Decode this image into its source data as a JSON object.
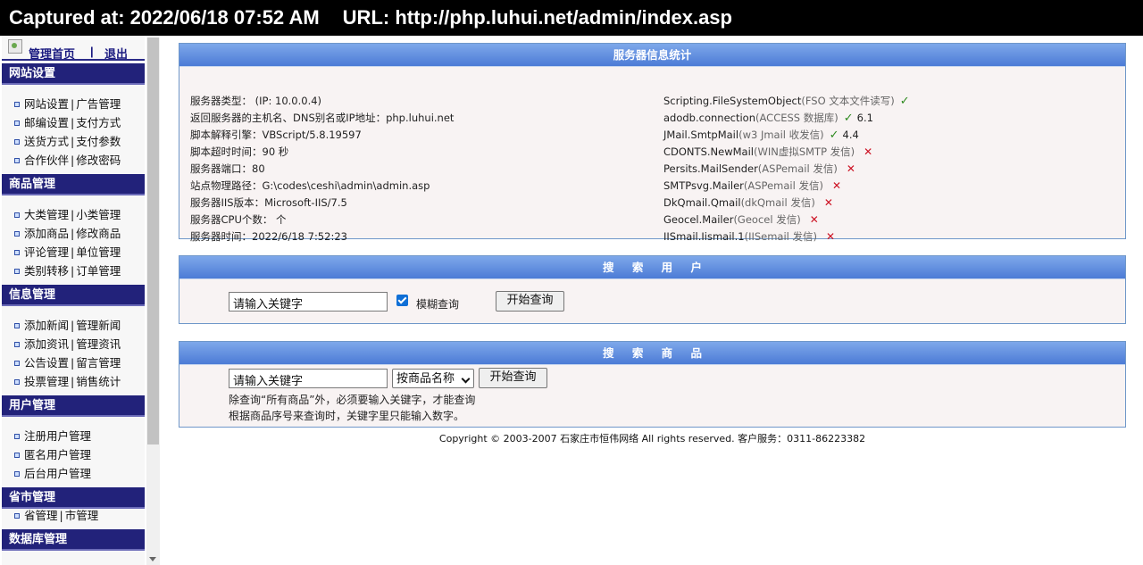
{
  "banner": {
    "captured": "Captured at: 2022/06/18 07:52 AM",
    "url": "URL: http://php.luhui.net/admin/index.asp"
  },
  "sidebar": {
    "top": {
      "home": "管理首页",
      "separator": "|",
      "logout": "退出"
    },
    "sections": [
      {
        "title": "网站设置",
        "rows": [
          [
            "网站设置",
            "广告管理"
          ],
          [
            "邮编设置",
            "支付方式"
          ],
          [
            "送货方式",
            "支付参数"
          ],
          [
            "合作伙伴",
            "修改密码"
          ]
        ]
      },
      {
        "title": "商品管理",
        "rows": [
          [
            "大类管理",
            "小类管理"
          ],
          [
            "添加商品",
            "修改商品"
          ],
          [
            "评论管理",
            "单位管理"
          ],
          [
            "类别转移",
            "订单管理"
          ]
        ]
      },
      {
        "title": "信息管理",
        "rows": [
          [
            "添加新闻",
            "管理新闻"
          ],
          [
            "添加资讯",
            "管理资讯"
          ],
          [
            "公告设置",
            "留言管理"
          ],
          [
            "投票管理",
            "销售统计"
          ]
        ]
      },
      {
        "title": "用户管理",
        "rows": [
          [
            "注册用户管理"
          ],
          [
            "匿名用户管理"
          ],
          [
            "后台用户管理"
          ]
        ]
      },
      {
        "title": "省市管理",
        "rows": [
          [
            "省管理",
            "市管理"
          ]
        ]
      },
      {
        "title": "数据库管理",
        "rows": []
      }
    ]
  },
  "server_info": {
    "title": "服务器信息统计",
    "left": [
      {
        "label": "服务器类型：",
        "value": "  (IP: 10.0.0.4)"
      },
      {
        "label": "返回服务器的主机名、DNS别名或IP地址：",
        "value": "php.luhui.net"
      },
      {
        "label": "脚本解释引擎：",
        "value": "VBScript/5.8.19597"
      },
      {
        "label": "脚本超时时间：",
        "value": "90 秒"
      },
      {
        "label": "服务器端口：",
        "value": "80"
      },
      {
        "label": "站点物理路径：",
        "value": "G:\\codes\\ceshi\\admin\\admin.asp"
      },
      {
        "label": "服务器IIS版本：",
        "value": "Microsoft-IIS/7.5"
      },
      {
        "label": "服务器CPU个数：",
        "value": " 个"
      },
      {
        "label": "服务器时间：",
        "value": "2022/6/18 7:52:23"
      }
    ],
    "right": [
      {
        "name": "Scripting.FileSystemObject",
        "note": "(FSO 文本文件读写)",
        "status": "ok",
        "version": ""
      },
      {
        "name": "adodb.connection",
        "note": "(ACCESS 数据库)",
        "status": "ok",
        "version": "6.1"
      },
      {
        "name": "JMail.SmtpMail",
        "note": "(w3 Jmail 收发信)",
        "status": "ok",
        "version": "4.4"
      },
      {
        "name": "CDONTS.NewMail",
        "note": "(WIN虚拟SMTP 发信)",
        "status": "no",
        "version": ""
      },
      {
        "name": "Persits.MailSender",
        "note": "(ASPemail 发信)",
        "status": "no",
        "version": ""
      },
      {
        "name": "SMTPsvg.Mailer",
        "note": "(ASPemail 发信)",
        "status": "no",
        "version": ""
      },
      {
        "name": "DkQmail.Qmail",
        "note": "(dkQmail 发信)",
        "status": "no",
        "version": ""
      },
      {
        "name": "Geocel.Mailer",
        "note": "(Geocel 发信)",
        "status": "no",
        "version": ""
      },
      {
        "name": "IISmail.Iismail.1",
        "note": "(IISemail 发信)",
        "status": "no",
        "version": ""
      }
    ],
    "ok_mark": "✓",
    "no_mark": "✕"
  },
  "search_user": {
    "title": "搜 索 用 户",
    "input_value": "请输入关键字",
    "checkbox_label": "模糊查询",
    "checkbox_checked": true,
    "button": "开始查询"
  },
  "search_goods": {
    "title": "搜 索 商 品",
    "input_value": "请输入关键字",
    "select_value": "按商品名称",
    "button": "开始查询",
    "note1": "除查询“所有商品”外，必须要输入关键字，才能查询",
    "note2": "根据商品序号来查询时，关键字里只能输入数字。"
  },
  "footer": "Copyright © 2003-2007 石家庄市恒伟网络 All rights reserved. 客户服务：0311-86223382",
  "colors": {
    "section_header": "#22227a",
    "panel_header": "#5a88dc",
    "ok": "#2d8a1f",
    "no": "#cc1122"
  }
}
